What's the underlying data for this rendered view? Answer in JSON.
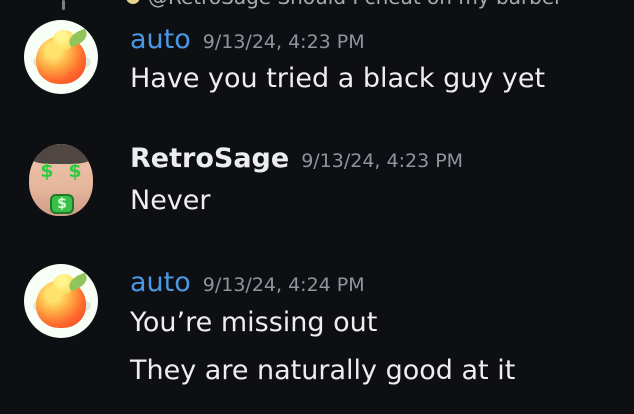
{
  "reply": {
    "text": "@RetroSage Should I cheat on my barber"
  },
  "messages": [
    {
      "author": "auto",
      "timestamp": "9/13/24, 4:23 PM",
      "lines": [
        "Have you tried a black guy yet"
      ],
      "avatar": "pear-avatar"
    },
    {
      "author": "RetroSage",
      "timestamp": "9/13/24, 4:23 PM",
      "lines": [
        "Never"
      ],
      "avatar": "money-face-avatar"
    },
    {
      "author": "auto",
      "timestamp": "9/13/24, 4:24 PM",
      "lines": [
        "You’re missing out",
        "They are naturally good at it"
      ],
      "avatar": "pear-avatar"
    }
  ],
  "colors": {
    "background": "#0e0f12",
    "username_auto": "#4a98e3",
    "username_retro": "#ecedf1",
    "timestamp": "#9194a0",
    "message_text": "#eeeef2"
  },
  "icons": {
    "reply_icon": "reply-avatar-icon",
    "money_symbol": "$"
  }
}
